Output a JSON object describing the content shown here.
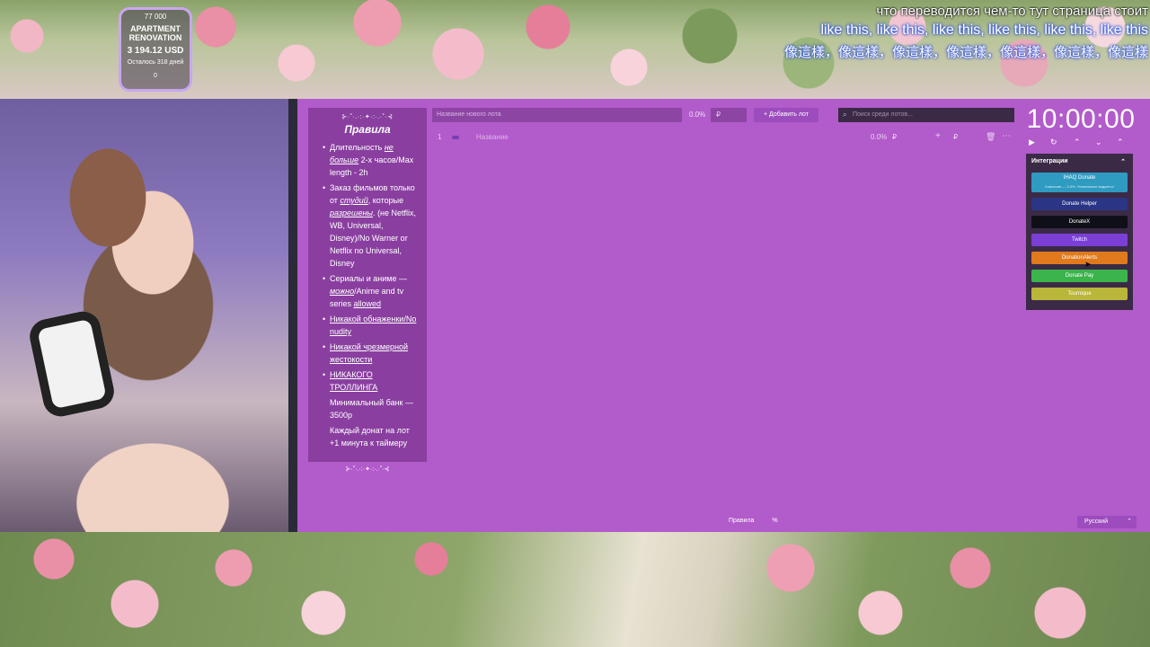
{
  "goal": {
    "top_value": "77 000",
    "name": "APARTMENT RENOVATION",
    "amount": "3 194.12 USD",
    "remaining": "Осталось 318 дней",
    "bottom_value": "0"
  },
  "subtitles": {
    "line1": "что переводится чем-то тут страница стоит",
    "line2": "like this, like this, like this, like this, like this, like this",
    "line3": "像這樣，像這樣，像這樣，像這樣，像這樣，像這樣，像這樣"
  },
  "rules": {
    "deco_top": "⊱·˚·.·:·✦·:·.·˚·⊰",
    "title": "Правила",
    "items": {
      "r1a": "Длительность ",
      "r1b": "не больше",
      "r1c": " 2-х часов/Max length - 2h",
      "r2a": "Заказ фильмов только от ",
      "r2b": "студий",
      "r2c": ", которые ",
      "r2d": "разрешены",
      "r2e": ". (не Netflix, WB, Universal, Disney)/No Warner or Netflix no Universal, Disney",
      "r3a": "Сериалы и аниме — ",
      "r3b": "можно",
      "r3c": "/Anime and tv series ",
      "r3d": "allowed",
      "r4": "Никакой обнаженки/No nudity",
      "r5": "Никакой чрезмерной жестокости",
      "r6": "НИКАКОГО ТРОЛЛИНГА",
      "r7": "Минимальный банк — 3500р",
      "r8": "Каждый донат на лот +1 минута к таймеру"
    },
    "deco_bottom": "⊱·˚·.·:·✦·:·.·˚·⊰"
  },
  "topbar": {
    "lot_name_placeholder": "Название нового лота",
    "percent": "0.0%",
    "currency": "₽",
    "add_label": "+  Добавить лот",
    "search_placeholder": "Поиск среди лотов..."
  },
  "lot": {
    "number": "1",
    "name_placeholder": "Название",
    "percent": "0.0%",
    "currency": "₽",
    "plus": "+",
    "amount_currency": "₽"
  },
  "timer": {
    "value": "10:00:00",
    "play": "▶",
    "reset": "↻",
    "up": "⌃",
    "down": "⌄",
    "up2": "⌃"
  },
  "integrations": {
    "title": "Интеграции",
    "items": [
      {
        "label": "IHAQ Donate",
        "sub": "Комиссия — 3,5%. Уникальные виджеты!",
        "color": "#2f9bc0"
      },
      {
        "label": "Donate Helper",
        "color": "#2a3585"
      },
      {
        "label": "DonateX",
        "color": "#0f0f18"
      },
      {
        "label": "Twitch",
        "color": "#7b3fd6"
      },
      {
        "label": "DonationAlerts",
        "color": "#e07a1c"
      },
      {
        "label": "Donate Pay",
        "color": "#3bb44c"
      },
      {
        "label": "Tournique",
        "color": "#b9b63a"
      }
    ]
  },
  "bottom": {
    "rules_label": "Правила",
    "percent_icon": "%",
    "language": "Русский"
  }
}
